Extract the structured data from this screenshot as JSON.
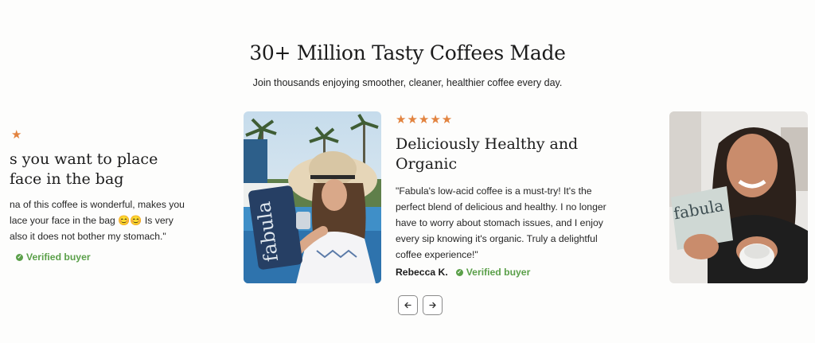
{
  "section": {
    "title": "30+ Million Tasty Coffees Made",
    "subtitle": "Join thousands enjoying smoother, cleaner, healthier coffee every day."
  },
  "reviews": [
    {
      "stars": "★",
      "heading_lines": [
        "s you want to place",
        "face in the bag"
      ],
      "quote_lines": [
        "na of this coffee is wonderful, makes you",
        "lace your face in the bag 😊😊 Is very",
        " also it does not bother my stomach.\""
      ],
      "verified": "Verified buyer"
    },
    {
      "stars": "★★★★★",
      "heading": "Deliciously Healthy and Organic",
      "quote": "\"Fabula's low-acid coffee is a must-try! It's the perfect blend of delicious and healthy. I no longer have to worry about stomach issues, and I enjoy every sip knowing it's organic. Truly a delightful coffee experience!\"",
      "reviewer": "Rebecca K.",
      "verified": "Verified buyer",
      "bag_label": "fabula"
    },
    {
      "bag_label": "fabula"
    }
  ],
  "nav": {
    "prev_icon": "arrow-left-icon",
    "next_icon": "arrow-right-icon"
  },
  "colors": {
    "star": "#e2833f",
    "verified": "#5ba04a"
  }
}
